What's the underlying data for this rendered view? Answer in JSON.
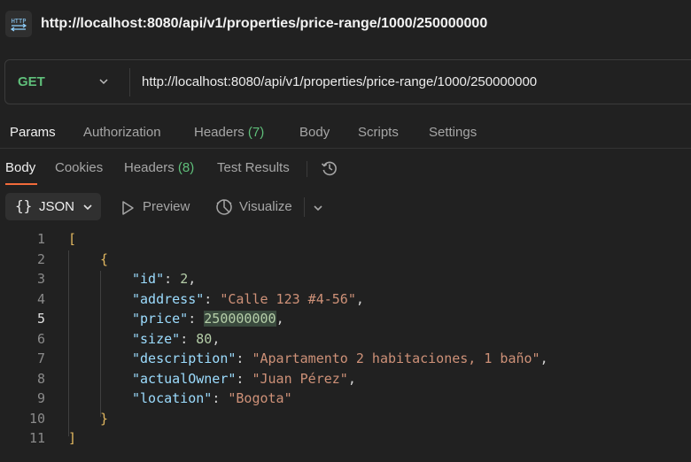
{
  "title_bar": {
    "icon": "http-icon",
    "title": "http://localhost:8080/api/v1/properties/price-range/1000/250000000"
  },
  "request": {
    "method": "GET",
    "url": "http://localhost:8080/api/v1/properties/price-range/1000/250000000",
    "method_color": "#5fbf7a"
  },
  "request_tabs": {
    "params": "Params",
    "authorization": "Authorization",
    "headers": "Headers",
    "headers_count": "(7)",
    "body": "Body",
    "scripts": "Scripts",
    "settings": "Settings",
    "active": "Params"
  },
  "response_tabs": {
    "body": "Body",
    "cookies": "Cookies",
    "headers": "Headers",
    "headers_count": "(8)",
    "test_results": "Test Results",
    "active": "Body",
    "history_icon": "history-icon"
  },
  "view_bar": {
    "format": "JSON",
    "preview": "Preview",
    "visualize": "Visualize"
  },
  "colors": {
    "accent": "#f26b3a",
    "count": "#5fbf7a",
    "background": "#212121"
  },
  "response_body": {
    "line_numbers": [
      "1",
      "2",
      "3",
      "4",
      "5",
      "6",
      "7",
      "8",
      "9",
      "10",
      "11"
    ],
    "current_line": "5",
    "open_array": "[",
    "open_object": "{",
    "fields": [
      {
        "key": "\"id\"",
        "value": "2",
        "type": "number"
      },
      {
        "key": "\"address\"",
        "value": "\"Calle 123 #4-56\"",
        "type": "string"
      },
      {
        "key": "\"price\"",
        "value": "250000000",
        "type": "number"
      },
      {
        "key": "\"size\"",
        "value": "80",
        "type": "number"
      },
      {
        "key": "\"description\"",
        "value": "\"Apartamento 2 habitaciones, 1 baño\"",
        "type": "string"
      },
      {
        "key": "\"actualOwner\"",
        "value": "\"Juan Pérez\"",
        "type": "string"
      },
      {
        "key": "\"location\"",
        "value": "\"Bogota\"",
        "type": "string"
      }
    ],
    "close_object": "}",
    "close_array": "]"
  }
}
